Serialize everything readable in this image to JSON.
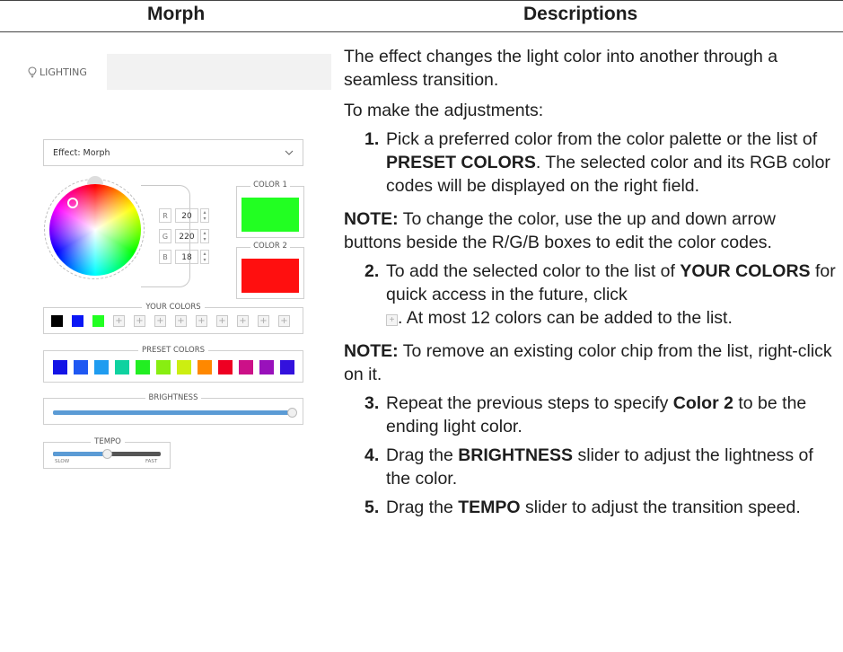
{
  "header": {
    "col_morph": "Morph",
    "col_desc": "Descriptions"
  },
  "panel": {
    "tab_label": "LIGHTING",
    "effect_label": "Effect: Morph",
    "rgb": [
      {
        "label": "R",
        "value": "20"
      },
      {
        "label": "G",
        "value": "220"
      },
      {
        "label": "B",
        "value": "18"
      }
    ],
    "color1": {
      "label": "COLOR 1",
      "hex": "#22ff22"
    },
    "color2": {
      "label": "COLOR 2",
      "hex": "#ff0f0f"
    },
    "your_colors": {
      "label": "YOUR COLORS",
      "filled": [
        "#000000",
        "#0a17f5",
        "#22ff22"
      ],
      "empty_count": 9,
      "add_symbol": "+"
    },
    "preset_colors": {
      "label": "PRESET COLORS",
      "colors": [
        "#1414e6",
        "#1f58f2",
        "#1f9cf0",
        "#0fd2a0",
        "#22ee22",
        "#88ee11",
        "#ccee11",
        "#ff8800",
        "#ee0022",
        "#cc1188",
        "#9911bb",
        "#3311dd"
      ]
    },
    "brightness": {
      "label": "BRIGHTNESS",
      "level": 1.0
    },
    "tempo": {
      "label": "TEMPO",
      "level": 0.5,
      "min_label": "SLOW",
      "max_label": "FAST"
    },
    "accent": "#5b9bd5"
  },
  "desc": {
    "intro": "The effect changes the light color into another through a seamless transition.",
    "adjust": "To make the adjustments:",
    "step1": {
      "num": "1.",
      "a": "Pick a preferred color from the color palette or the list of ",
      "b": "PRESET COLORS",
      "c": ". The selected color and its RGB color codes will be displayed on the right field."
    },
    "note1": {
      "label": "NOTE:",
      "text": " To change the color, use the up and down arrow buttons beside the R/G/B boxes to edit the color codes."
    },
    "step2": {
      "num": "2.",
      "a": "To add the selected color to the list of ",
      "b": "YOUR COLORS",
      "c": " for quick access in the future, click",
      "d": ". At most 12 colors can be added to the list."
    },
    "note2": {
      "label": "NOTE:",
      "text": " To remove an existing color chip from the list, right-click on it."
    },
    "step3": {
      "num": "3.",
      "a": "Repeat the previous steps to specify ",
      "b": "Color 2",
      "c": " to be the ending light color."
    },
    "step4": {
      "num": "4.",
      "a": "Drag the ",
      "b": "BRIGHTNESS",
      "c": " slider to adjust the lightness of the color."
    },
    "step5": {
      "num": "5.",
      "a": "Drag the ",
      "b": "TEMPO",
      "c": " slider to adjust the transition speed."
    }
  }
}
